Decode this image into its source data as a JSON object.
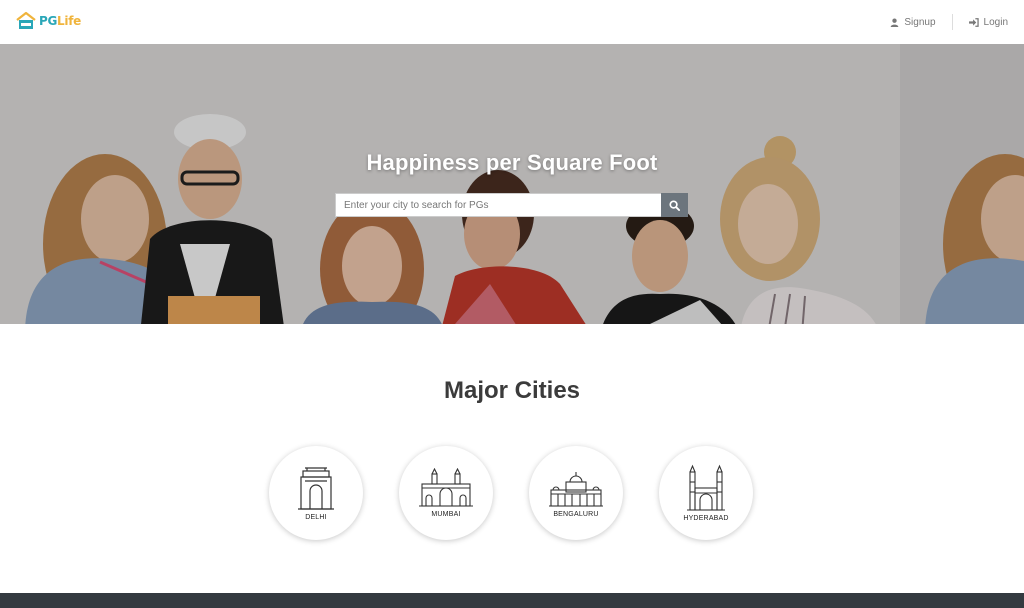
{
  "logo": {
    "brand_pg": "PG",
    "brand_life": "Life"
  },
  "nav": {
    "signup": "Signup",
    "login": "Login"
  },
  "hero": {
    "title": "Happiness per Square Foot",
    "search_placeholder": "Enter your city to search for PGs"
  },
  "section": {
    "title": "Major Cities"
  },
  "cities": [
    {
      "label": "DELHI",
      "icon": "india-gate-icon"
    },
    {
      "label": "MUMBAI",
      "icon": "gateway-of-india-icon"
    },
    {
      "label": "BENGALURU",
      "icon": "vidhana-soudha-icon"
    },
    {
      "label": "HYDERABAD",
      "icon": "charminar-icon"
    }
  ],
  "colors": {
    "accent_teal": "#2aa7b8",
    "accent_yellow": "#f0b43c",
    "search_button": "#6c757d",
    "footer": "#343a40"
  }
}
